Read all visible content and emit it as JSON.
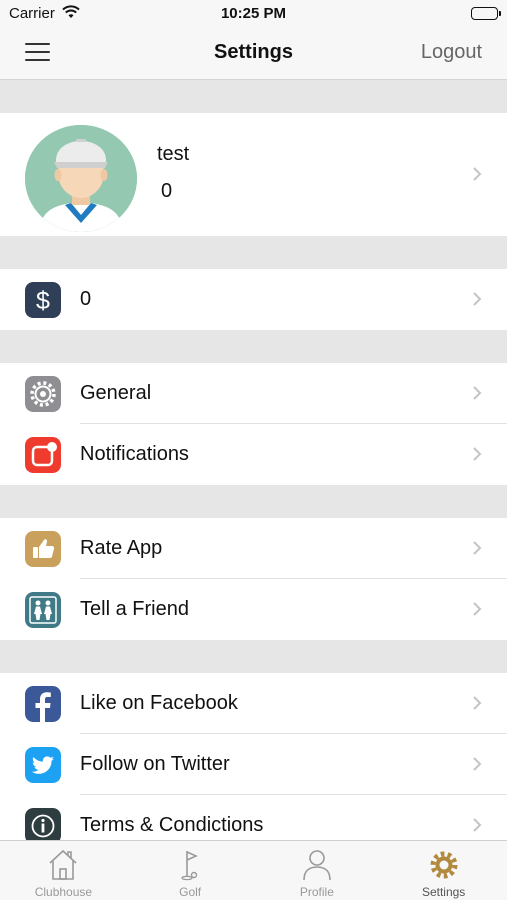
{
  "status_bar": {
    "carrier": "Carrier",
    "time": "10:25 PM"
  },
  "nav": {
    "title": "Settings",
    "logout": "Logout"
  },
  "profile": {
    "name": "test",
    "score": "0"
  },
  "balance": {
    "value": "0"
  },
  "settings": {
    "general": "General",
    "notifications": "Notifications",
    "rate_app": "Rate App",
    "tell_friend": "Tell a Friend",
    "facebook": "Like on Facebook",
    "twitter": "Follow on Twitter",
    "terms": "Terms & Condictions"
  },
  "tabs": [
    {
      "label": "Clubhouse",
      "icon": "clubhouse-icon",
      "active": false
    },
    {
      "label": "Golf",
      "icon": "golf-flag-icon",
      "active": false
    },
    {
      "label": "Profile",
      "icon": "profile-icon",
      "active": false
    },
    {
      "label": "Settings",
      "icon": "gear-icon",
      "active": true
    }
  ],
  "colors": {
    "balance_icon": "#2f3f57",
    "general_icon": "#8e8e93",
    "notifications_icon": "#ef3b2e",
    "rate_icon": "#c9a15c",
    "tell_friend_icon": "#3f7a86",
    "facebook_icon": "#3b5998",
    "twitter_icon": "#1da1f2",
    "terms_icon": "#2e3d40",
    "active_tab_icon": "#b18a3f"
  }
}
